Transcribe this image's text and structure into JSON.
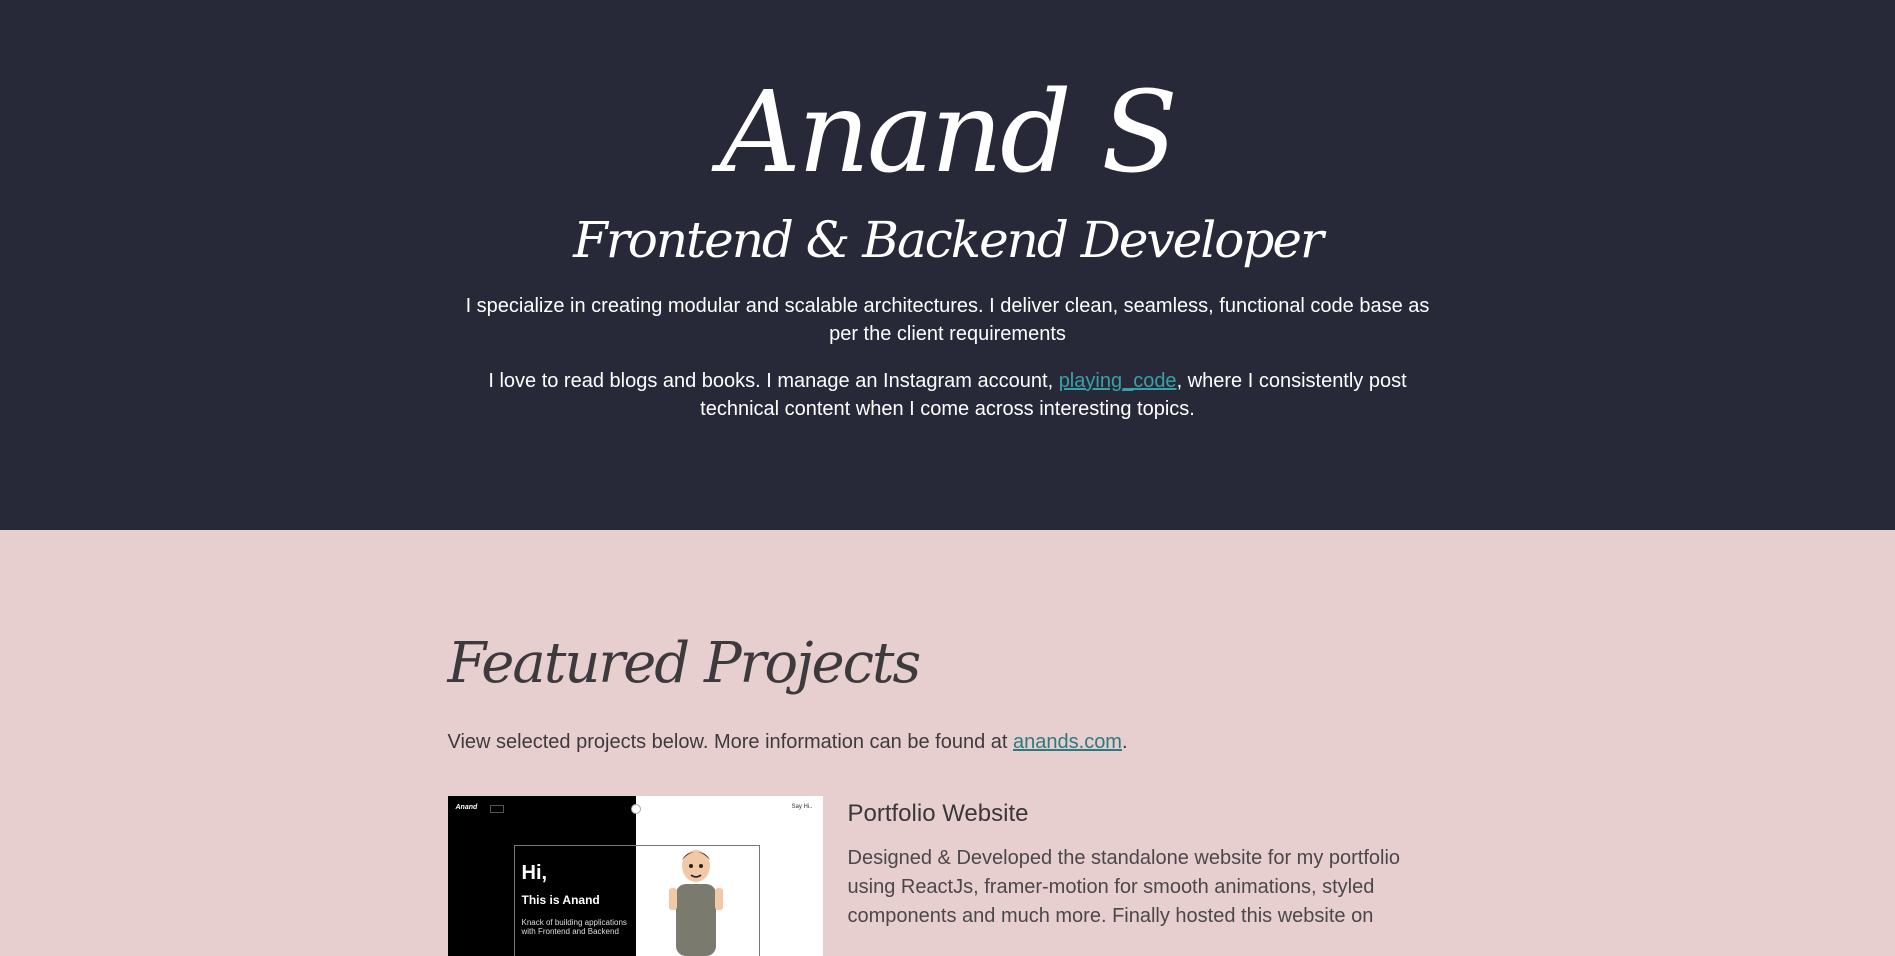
{
  "hero": {
    "name": "Anand S",
    "role": "Frontend & Backend Developer",
    "bio1": "I specialize in creating modular and scalable architectures. I deliver clean, seamless, functional code base as per the client requirements",
    "bio2_before": "I love to read blogs and books. I manage an Instagram account, ",
    "bio2_link": "playing_code",
    "bio2_after": ", where I consistently post technical content when I come across interesting topics."
  },
  "projects": {
    "title": "Featured Projects",
    "intro_before": "View selected projects below. More information can be found at ",
    "intro_link": "anands.com",
    "intro_after": ".",
    "items": [
      {
        "title": "Portfolio Website",
        "description": "Designed & Developed the standalone website for my portfolio using ReactJs, framer-motion for smooth animations, styled components and much more. Finally hosted this website on",
        "thumbnail": {
          "logo": "Anand",
          "greeting": "Hi,",
          "subtitle": "This is Anand",
          "tagline": "Knack of building applications with Frontend and Backend",
          "say_hi": "Say Hi.."
        }
      }
    ]
  },
  "colors": {
    "hero_bg": "#272938",
    "page_bg": "#e8cfcf",
    "link_hero": "#3aa0a8",
    "link_body": "#2c7a80"
  }
}
